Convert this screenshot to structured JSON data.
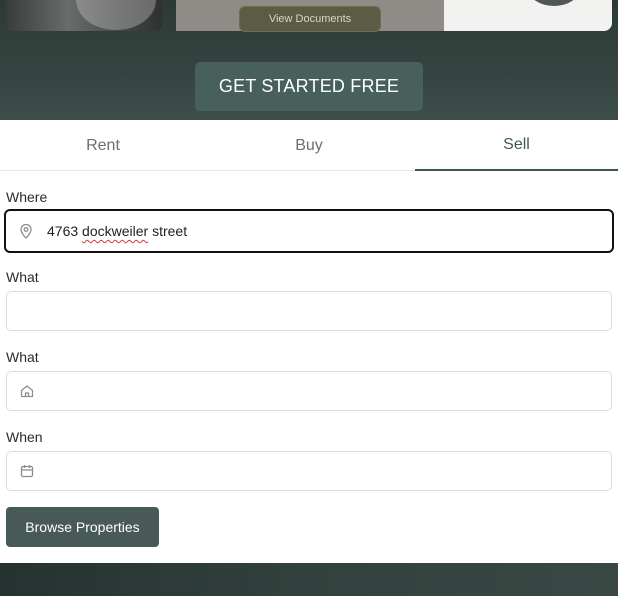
{
  "hero": {
    "view_documents_label": "View Documents",
    "cta_label": "GET STARTED FREE"
  },
  "tabs": [
    {
      "label": "Rent",
      "active": false
    },
    {
      "label": "Buy",
      "active": false
    },
    {
      "label": "Sell",
      "active": true
    }
  ],
  "form": {
    "where": {
      "label": "Where",
      "value_part1": "4763 ",
      "value_misspelled": "dockweiler",
      "value_part2": " street",
      "icon": "map-pin-icon"
    },
    "what_text": {
      "label": "What",
      "value": "",
      "placeholder": ""
    },
    "what_property": {
      "label": "What",
      "value": "",
      "placeholder": "",
      "icon": "home-icon"
    },
    "when": {
      "label": "When",
      "value": "",
      "placeholder": "",
      "icon": "calendar-icon"
    },
    "submit_label": "Browse Properties"
  },
  "colors": {
    "accent": "#475a57",
    "active_tab": "#3f5753",
    "hero_bg": "#34433f"
  }
}
